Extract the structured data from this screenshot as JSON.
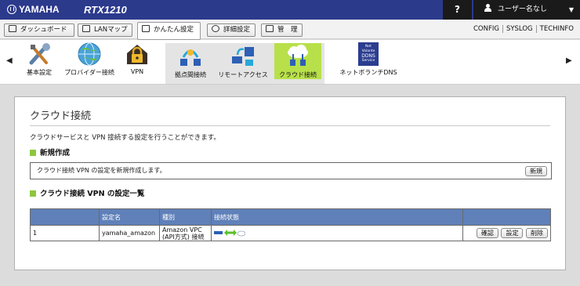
{
  "header": {
    "brand": "YAMAHA",
    "model": "RTX1210",
    "help": "?",
    "user": "ユーザー名なし",
    "user_caret": "▼"
  },
  "tabs": [
    {
      "label": "ダッシュボード",
      "active": false
    },
    {
      "label": "LANマップ",
      "active": false
    },
    {
      "label": "かんたん設定",
      "active": true
    },
    {
      "label": "詳細設定",
      "active": false
    },
    {
      "label": "管　理",
      "active": false
    }
  ],
  "top_links": [
    "CONFIG",
    "SYSLOG",
    "TECHINFO"
  ],
  "iconbar": {
    "left_arrow": "◀",
    "right_arrow": "▶",
    "items": [
      {
        "label": "基本設定",
        "icon": "wrench-screwdriver-icon"
      },
      {
        "label": "プロバイダー接続",
        "icon": "globe-icon"
      },
      {
        "label": "VPN",
        "icon": "lock-house-icon"
      },
      {
        "label": "拠点間接続",
        "icon": "site-to-site-icon"
      },
      {
        "label": "リモートアクセス",
        "icon": "remote-access-icon"
      },
      {
        "label": "クラウド接続",
        "icon": "cloud-icon",
        "selected": true
      },
      {
        "label": "ネットボランチDNS",
        "icon": "ddns-icon",
        "badge_top": "Net Volante",
        "badge_mid": "DDNS",
        "badge_bot": "Service"
      }
    ]
  },
  "page": {
    "title": "クラウド接続",
    "description": "クラウドサービスと VPN 接続する設定を行うことができます。",
    "new_section": {
      "heading": "新規作成",
      "text": "クラウド接続 VPN の設定を新規作成します。",
      "button": "新規"
    },
    "list_section": {
      "heading": "クラウド接続 VPN の設定一覧",
      "columns": [
        "",
        "設定名",
        "種別",
        "接続状態",
        ""
      ],
      "rows": [
        {
          "no": "1",
          "name": "yamaha_amazon",
          "type": "Amazon VPC (API方式) 接続",
          "buttons": [
            "確認",
            "設定",
            "削除"
          ]
        }
      ]
    }
  },
  "colors": {
    "header_bg": "#2c3a8c",
    "table_header": "#5f80b9",
    "section_marker": "#8dc640",
    "selected_nav": "#b8e04a"
  }
}
